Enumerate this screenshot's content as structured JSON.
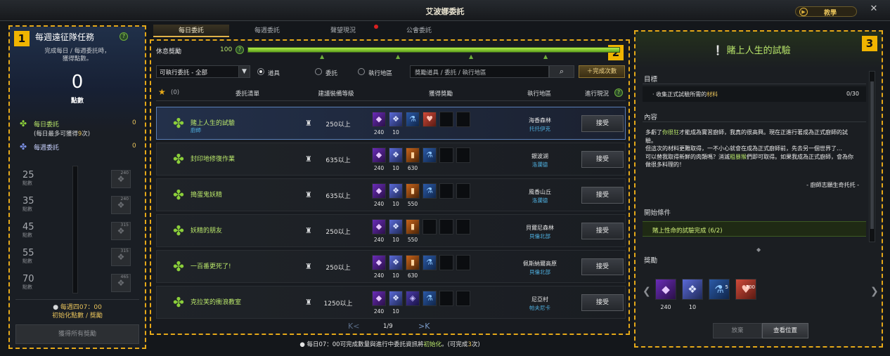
{
  "window": {
    "title": "艾波娜委託",
    "tutorial_label": "教學",
    "close_symbol": "✕"
  },
  "tabs": [
    {
      "label": "每日委託",
      "active": true
    },
    {
      "label": "每週委託",
      "active": false
    },
    {
      "label": "聲望現況",
      "active": false
    },
    {
      "label": "公會委託",
      "active": false
    }
  ],
  "badges": {
    "one": "1",
    "two": "2",
    "three": "3"
  },
  "left": {
    "title": "每週遠征隊任務",
    "help": "?",
    "subtitle_line1": "完成每日 / 每週委託時，",
    "subtitle_line2": "獲得點數。",
    "score": "0",
    "score_unit": "點數",
    "daily_label": "每日委託",
    "daily_note_prefix": "(每日最多可獲得",
    "daily_note_num": "9",
    "daily_note_suffix": "次)",
    "daily_value": "0",
    "weekly_label": "每週委託",
    "weekly_value": "0",
    "levels": [
      {
        "points": "25",
        "unit": "點數",
        "box_num": "240"
      },
      {
        "points": "35",
        "unit": "點數",
        "box_num": "240"
      },
      {
        "points": "45",
        "unit": "點數",
        "box_num": "315"
      },
      {
        "points": "55",
        "unit": "點數",
        "box_num": "315"
      },
      {
        "points": "70",
        "unit": "點數",
        "box_num": "465"
      }
    ],
    "reset_line1": "每週四07：00",
    "reset_line2": "初始化點數 / 獎勵",
    "claim_all": "獲得所有獎勵"
  },
  "mid": {
    "rest_label": "休息獎勵",
    "rest_value": "100",
    "rest_fill_percent": 100,
    "filter_value": "可執行委託 - 全部",
    "radios": [
      {
        "label": "道具",
        "selected": true
      },
      {
        "label": "委託",
        "selected": false
      },
      {
        "label": "執行地區",
        "selected": false
      }
    ],
    "search_placeholder": "獎勵道具 / 委託 / 執行地區",
    "complete_count_label": "＋完成次數",
    "columns": {
      "fav_count": "(0)",
      "quest": "委託清單",
      "level": "建議裝備等級",
      "reward": "獲得獎勵",
      "region": "執行地區",
      "progress": "進行現況"
    },
    "accept_label": "接受",
    "rows": [
      {
        "name": "賭上人生的試驗",
        "sub": "廚師",
        "level": "250以上",
        "region": "海香森林",
        "npc": "托托伊克",
        "rewards": [
          {
            "icon": "purple-crystal",
            "count": "240"
          },
          {
            "icon": "blue-crystal",
            "count": "10"
          },
          {
            "icon": "potion",
            "count": ""
          },
          {
            "icon": "heart-fruit",
            "count": ""
          }
        ]
      },
      {
        "name": "封印地修復作業",
        "sub": "",
        "level": "635以上",
        "region": "銀波湖",
        "npc": "洛瀾德",
        "rewards": [
          {
            "icon": "purple-crystal",
            "count": "240"
          },
          {
            "icon": "blue-crystal",
            "count": "10"
          },
          {
            "icon": "orange-lantern",
            "count": "630"
          },
          {
            "icon": "potion",
            "count": ""
          }
        ]
      },
      {
        "name": "搗蛋鬼妖精",
        "sub": "",
        "level": "635以上",
        "region": "風香山丘",
        "npc": "洛瀾德",
        "rewards": [
          {
            "icon": "purple-crystal",
            "count": "240"
          },
          {
            "icon": "blue-crystal",
            "count": "10"
          },
          {
            "icon": "orange-lantern",
            "count": "550"
          },
          {
            "icon": "potion",
            "count": ""
          }
        ]
      },
      {
        "name": "妖精的朋友",
        "sub": "",
        "level": "250以上",
        "region": "貝爾尼森林",
        "npc": "貝倫北部",
        "rewards": [
          {
            "icon": "purple-crystal",
            "count": "240"
          },
          {
            "icon": "blue-crystal",
            "count": "10"
          },
          {
            "icon": "orange-lantern",
            "count": "550"
          },
          {
            "icon": "empty",
            "count": ""
          }
        ]
      },
      {
        "name": "一百番更死了!",
        "sub": "",
        "level": "250以上",
        "region": "佩斯納爾高原",
        "npc": "貝倫北部",
        "rewards": [
          {
            "icon": "purple-crystal",
            "count": "240"
          },
          {
            "icon": "blue-crystal",
            "count": "10"
          },
          {
            "icon": "orange-lantern",
            "count": "630"
          },
          {
            "icon": "potion",
            "count": ""
          }
        ]
      },
      {
        "name": "克拉芙的衝浪教室",
        "sub": "",
        "level": "1250以上",
        "region": "尼亞村",
        "npc": "帕夫尼卡",
        "rewards": [
          {
            "icon": "purple-crystal",
            "count": "240"
          },
          {
            "icon": "blue-crystal",
            "count": "10"
          },
          {
            "icon": "gem-box",
            "count": ""
          },
          {
            "icon": "potion",
            "count": ""
          }
        ]
      }
    ],
    "pager": {
      "prev": "K<",
      "current": "1/9",
      "next": ">K"
    },
    "notice_prefix": "每日07：00可完成數量與進行中委託資訊將",
    "notice_hl": "初始化",
    "notice_mid": "。(可完成",
    "notice_num": "3",
    "notice_suffix": "次)"
  },
  "right": {
    "title": "賭上人生的試驗",
    "goal_label": "目標",
    "goal_prefix": "· 收集正式試驗所需的",
    "goal_hl": "材料",
    "goal_count": "0/30",
    "content_label": "內容",
    "content_p1a": "多虧了",
    "content_p1b": "你很狂",
    "content_p1c": "才能成為實習廚師，我真的很高興。現在正進行著成為正式廚師的試驗。",
    "content_p2": "但這次的材料更難取得，一不小心就會在成為正式廚師前，先去另一個世界了…",
    "content_p3a": "可以替我取得新鮮的肉類嗎？消滅",
    "content_p3b": "粗暴猴",
    "content_p3c": "們即可取得。如果我成為正式廚師，會為你做很多料理的！",
    "content_sign": "- 廚師志願生奇托托 -",
    "cond_label": "開始條件",
    "cond_text": "賭上性命的試驗完成 (6/2)",
    "reward_label": "獎勵",
    "rewards": [
      {
        "icon": "purple-crystal",
        "count": "240",
        "badge": ""
      },
      {
        "icon": "blue-crystal",
        "count": "10",
        "badge": ""
      },
      {
        "icon": "potion",
        "count": "",
        "badge": "5"
      },
      {
        "icon": "heart-fruit",
        "count": "",
        "badge": "700"
      }
    ],
    "giveup": "放棄",
    "view_location": "查看位置"
  }
}
